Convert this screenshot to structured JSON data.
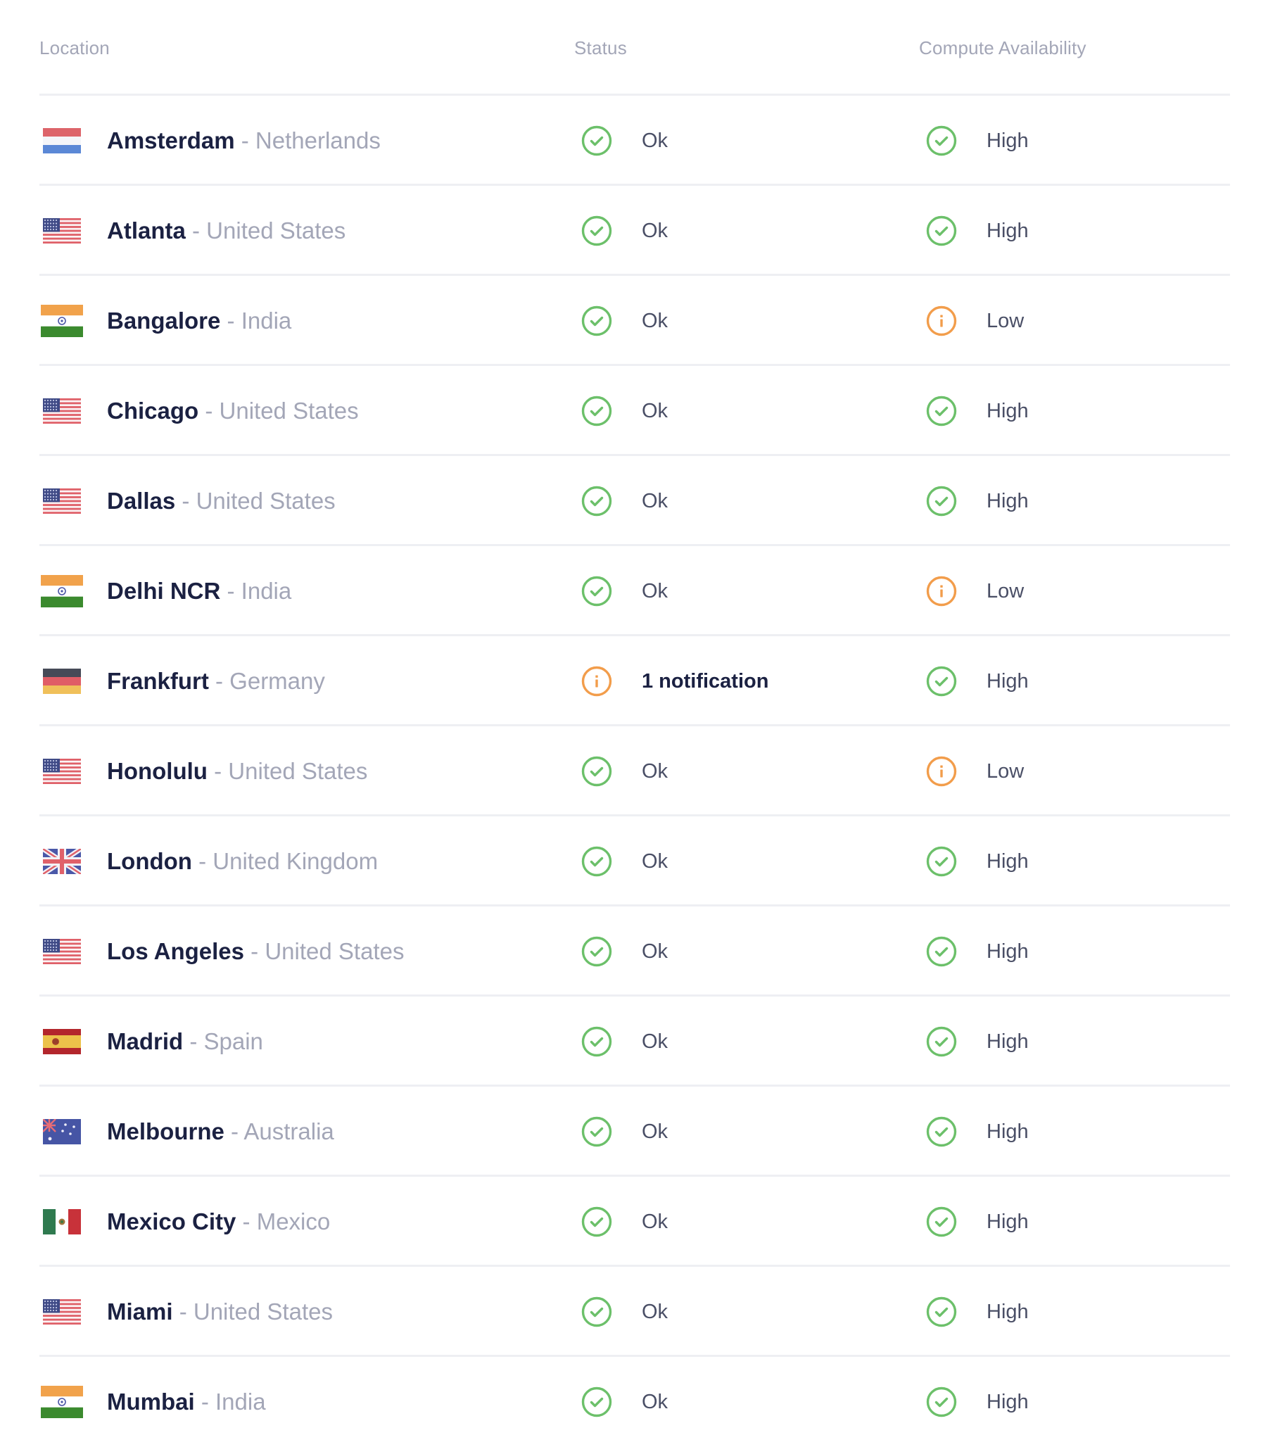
{
  "columns": {
    "location": "Location",
    "status": "Status",
    "compute": "Compute Availability"
  },
  "colors": {
    "ok": "#6cc06a",
    "warning": "#f29d4b",
    "city_text": "#1b2142",
    "muted_text": "#a3a6b7",
    "divider": "#eeeff3"
  },
  "rows": [
    {
      "city": "Amsterdam",
      "separator": " - ",
      "country": "Netherlands",
      "flag": "nl",
      "status": "Ok",
      "status_icon": "check-circle",
      "compute": "High",
      "compute_icon": "check-circle"
    },
    {
      "city": "Atlanta",
      "separator": " - ",
      "country": "United States",
      "flag": "us",
      "status": "Ok",
      "status_icon": "check-circle",
      "compute": "High",
      "compute_icon": "check-circle"
    },
    {
      "city": "Bangalore",
      "separator": " - ",
      "country": "India",
      "flag": "in",
      "status": "Ok",
      "status_icon": "check-circle",
      "compute": "Low",
      "compute_icon": "info-circle"
    },
    {
      "city": "Chicago",
      "separator": " - ",
      "country": "United States",
      "flag": "us",
      "status": "Ok",
      "status_icon": "check-circle",
      "compute": "High",
      "compute_icon": "check-circle"
    },
    {
      "city": "Dallas",
      "separator": " - ",
      "country": "United States",
      "flag": "us",
      "status": "Ok",
      "status_icon": "check-circle",
      "compute": "High",
      "compute_icon": "check-circle"
    },
    {
      "city": "Delhi NCR",
      "separator": " - ",
      "country": "India",
      "flag": "in",
      "status": "Ok",
      "status_icon": "check-circle",
      "compute": "Low",
      "compute_icon": "info-circle"
    },
    {
      "city": "Frankfurt",
      "separator": " - ",
      "country": "Germany",
      "flag": "de",
      "status": "1 notification",
      "status_icon": "info-circle",
      "status_is_link": true,
      "compute": "High",
      "compute_icon": "check-circle"
    },
    {
      "city": "Honolulu",
      "separator": " - ",
      "country": "United States",
      "flag": "us",
      "status": "Ok",
      "status_icon": "check-circle",
      "compute": "Low",
      "compute_icon": "info-circle"
    },
    {
      "city": "London",
      "separator": " - ",
      "country": "United Kingdom",
      "flag": "gb",
      "status": "Ok",
      "status_icon": "check-circle",
      "compute": "High",
      "compute_icon": "check-circle"
    },
    {
      "city": "Los Angeles",
      "separator": " - ",
      "country": "United States",
      "flag": "us",
      "status": "Ok",
      "status_icon": "check-circle",
      "compute": "High",
      "compute_icon": "check-circle"
    },
    {
      "city": "Madrid",
      "separator": " - ",
      "country": "Spain",
      "flag": "es",
      "status": "Ok",
      "status_icon": "check-circle",
      "compute": "High",
      "compute_icon": "check-circle"
    },
    {
      "city": "Melbourne",
      "separator": " - ",
      "country": "Australia",
      "flag": "au",
      "status": "Ok",
      "status_icon": "check-circle",
      "compute": "High",
      "compute_icon": "check-circle"
    },
    {
      "city": "Mexico City",
      "separator": " - ",
      "country": "Mexico",
      "flag": "mx",
      "status": "Ok",
      "status_icon": "check-circle",
      "compute": "High",
      "compute_icon": "check-circle"
    },
    {
      "city": "Miami",
      "separator": " - ",
      "country": "United States",
      "flag": "us",
      "status": "Ok",
      "status_icon": "check-circle",
      "compute": "High",
      "compute_icon": "check-circle"
    },
    {
      "city": "Mumbai",
      "separator": " - ",
      "country": "India",
      "flag": "in",
      "status": "Ok",
      "status_icon": "check-circle",
      "compute": "High",
      "compute_icon": "check-circle"
    }
  ]
}
